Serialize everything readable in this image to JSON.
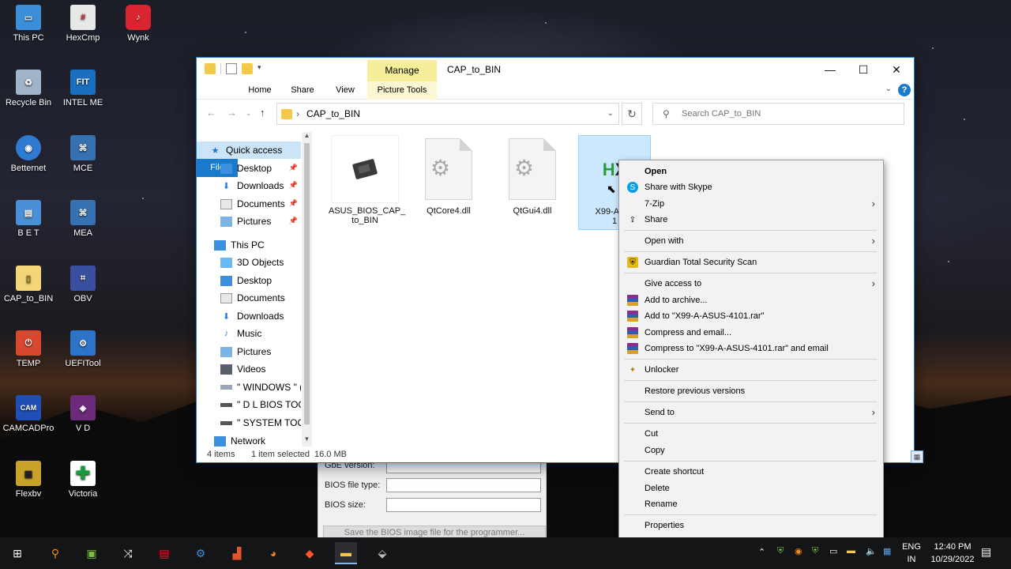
{
  "desktop": {
    "icons": [
      {
        "label": "This PC"
      },
      {
        "label": "HexCmp"
      },
      {
        "label": "Wynk"
      },
      {
        "label": "Recycle Bin"
      },
      {
        "label": "INTEL ME"
      },
      {
        "label": "Betternet"
      },
      {
        "label": "MCE"
      },
      {
        "label": "B E T"
      },
      {
        "label": "MEA"
      },
      {
        "label": "CAP_to_BIN"
      },
      {
        "label": "OBV"
      },
      {
        "label": "TEMP"
      },
      {
        "label": "UEFITool"
      },
      {
        "label": "CAMCADPro"
      },
      {
        "label": "V D"
      },
      {
        "label": "Flexbv"
      },
      {
        "label": "Victoria"
      }
    ]
  },
  "background_dialog": {
    "gbe_version_label": "GbE version:",
    "bios_file_type_label": "BIOS file type:",
    "bios_size_label": "BIOS size:",
    "save_button": "Save the BIOS image file for the programmer..."
  },
  "explorer": {
    "title": "CAP_to_BIN",
    "manage_tab": "Manage",
    "ribbon_tabs": {
      "file": "File",
      "home": "Home",
      "share": "Share",
      "view": "View",
      "picture_tools": "Picture Tools"
    },
    "address": {
      "path": "CAP_to_BIN"
    },
    "search": {
      "placeholder": "Search CAP_to_BIN"
    },
    "nav": {
      "quick_access": "Quick access",
      "desktop": "Desktop",
      "downloads": "Downloads",
      "documents": "Documents",
      "pictures": "Pictures",
      "this_pc": "This PC",
      "objects_3d": "3D Objects",
      "desktop2": "Desktop",
      "documents2": "Documents",
      "downloads2": "Downloads",
      "music": "Music",
      "pictures2": "Pictures",
      "videos": "Videos",
      "drive_windows": "\" WINDOWS \" (C",
      "drive_dl": "\" D L BIOS TOOL",
      "drive_system": "\" SYSTEM TOOLS",
      "network": "Network"
    },
    "files": [
      {
        "name_line1": "ASUS_BIOS_CAP_",
        "name_line2": "to_BIN"
      },
      {
        "name_line1": "QtCore4.dll",
        "name_line2": ""
      },
      {
        "name_line1": "QtGui4.dll",
        "name_line2": ""
      },
      {
        "name_line1": "X99-A-AS",
        "name_line2": "1"
      }
    ],
    "status": {
      "items": "4 items",
      "selected": "1 item selected",
      "size": "16.0 MB"
    }
  },
  "context_menu": {
    "open": "Open",
    "share_skype": "Share with Skype",
    "seven_zip": "7-Zip",
    "share": "Share",
    "open_with": "Open with",
    "guardian": "Guardian Total Security Scan",
    "give_access": "Give access to",
    "add_archive": "Add to archive...",
    "add_rar": "Add to \"X99-A-ASUS-4101.rar\"",
    "compress_email": "Compress and email...",
    "compress_rar_email": "Compress to \"X99-A-ASUS-4101.rar\" and email",
    "unlocker": "Unlocker",
    "restore": "Restore previous versions",
    "send_to": "Send to",
    "cut": "Cut",
    "copy": "Copy",
    "create_shortcut": "Create shortcut",
    "delete": "Delete",
    "rename": "Rename",
    "properties": "Properties"
  },
  "taskbar": {
    "language_line1": "ENG",
    "language_line2": "IN",
    "time": "12:40 PM",
    "date": "10/29/2022"
  },
  "colors": {
    "accent": "#1979ca",
    "selection": "#cce8ff",
    "manage_tab": "#f6ee9a"
  }
}
